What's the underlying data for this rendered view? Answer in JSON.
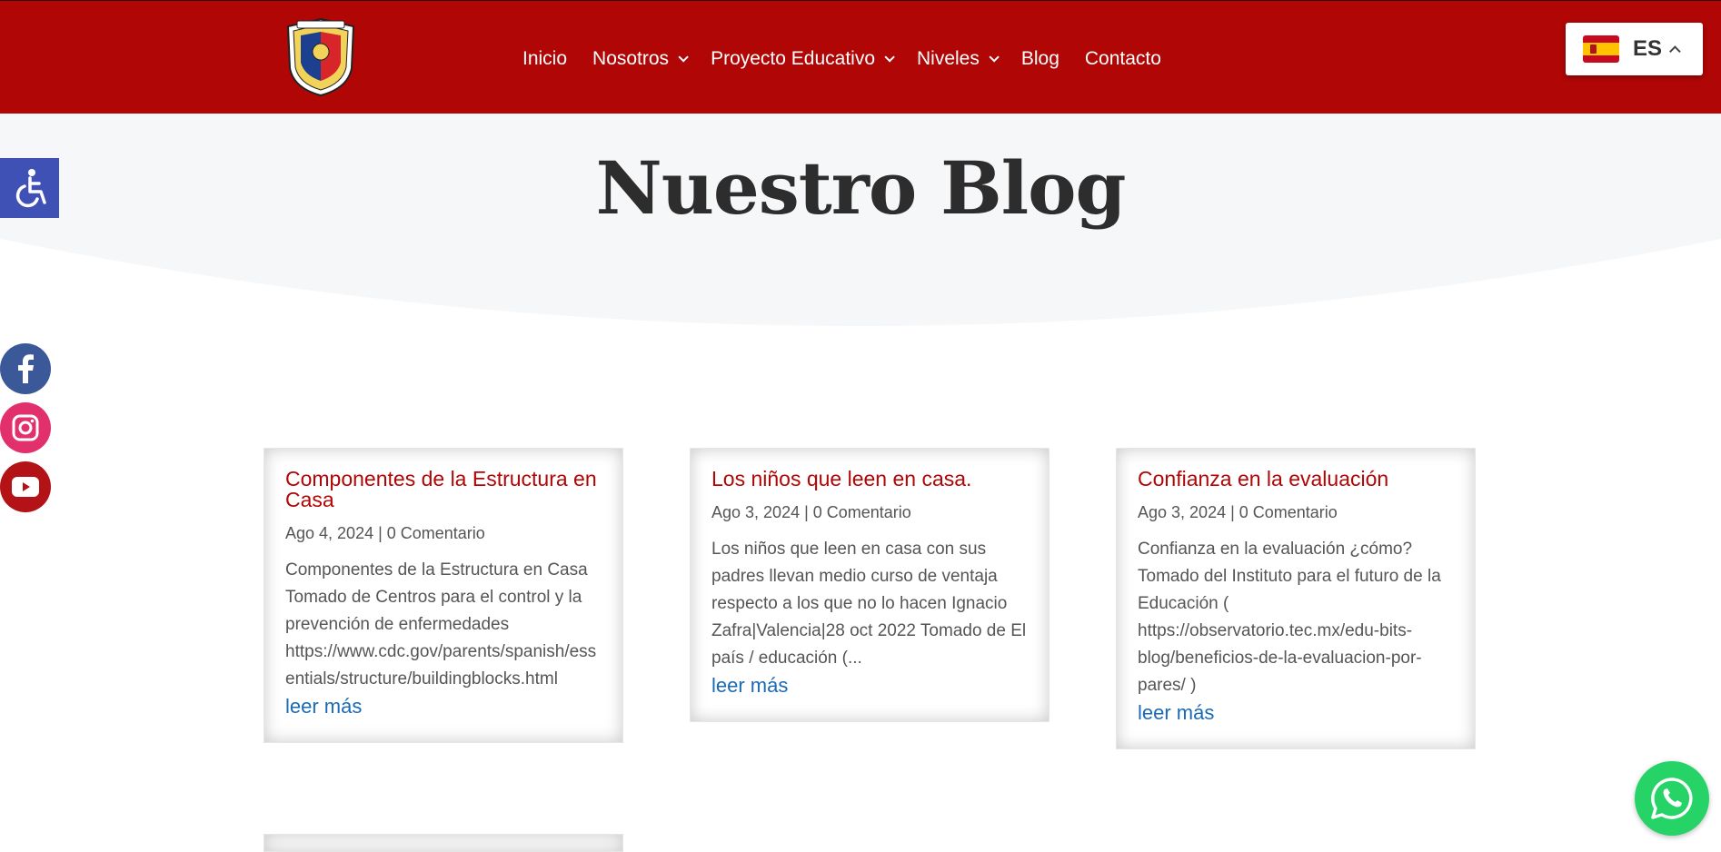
{
  "header": {
    "logo_icon": "school-crest-logo",
    "nav": [
      {
        "label": "Inicio",
        "dropdown": false
      },
      {
        "label": "Nosotros",
        "dropdown": true
      },
      {
        "label": "Proyecto Educativo",
        "dropdown": true
      },
      {
        "label": "Niveles",
        "dropdown": true
      },
      {
        "label": "Blog",
        "dropdown": false
      },
      {
        "label": "Contacto",
        "dropdown": false
      }
    ],
    "language": {
      "code": "ES",
      "flag_icon": "spain-flag-icon"
    },
    "background_color": "#b00606"
  },
  "hero": {
    "title": "Nuestro Blog",
    "background_color": "#f6f7f9"
  },
  "side_widgets": {
    "accessibility_icon": "wheelchair-icon",
    "social": [
      "facebook-icon",
      "instagram-icon",
      "youtube-icon"
    ]
  },
  "posts": [
    {
      "title": "Componentes de la Estructura en Casa",
      "meta": "Ago 4, 2024 | 0 Comentario",
      "excerpt": "Componentes de la Estructura en Casa   Tomado de Centros para el control y la prevención de enfermedades https://www.cdc.gov/parents/spanish/essentials/structure/buildingblocks.html",
      "more": "leer más"
    },
    {
      "title": "Los niños que leen en casa.",
      "meta": "Ago 3, 2024 | 0 Comentario",
      "excerpt": "Los niños que leen en casa con sus padres llevan medio curso de ventaja respecto a los que no lo hacen   Ignacio Zafra|Valencia|28 oct 2022   Tomado de El país / educación (...",
      "more": "leer más"
    },
    {
      "title": "Confianza en la evaluación",
      "meta": "Ago 3, 2024 | 0 Comentario",
      "excerpt": "Confianza en la evaluación ¿cómo? Tomado del Instituto para el futuro de la Educación ( https://observatorio.tec.mx/edu-bits-blog/beneficios-de-la-evaluacion-por-pares/ )",
      "more": "leer más"
    }
  ],
  "whatsapp_icon": "whatsapp-icon"
}
